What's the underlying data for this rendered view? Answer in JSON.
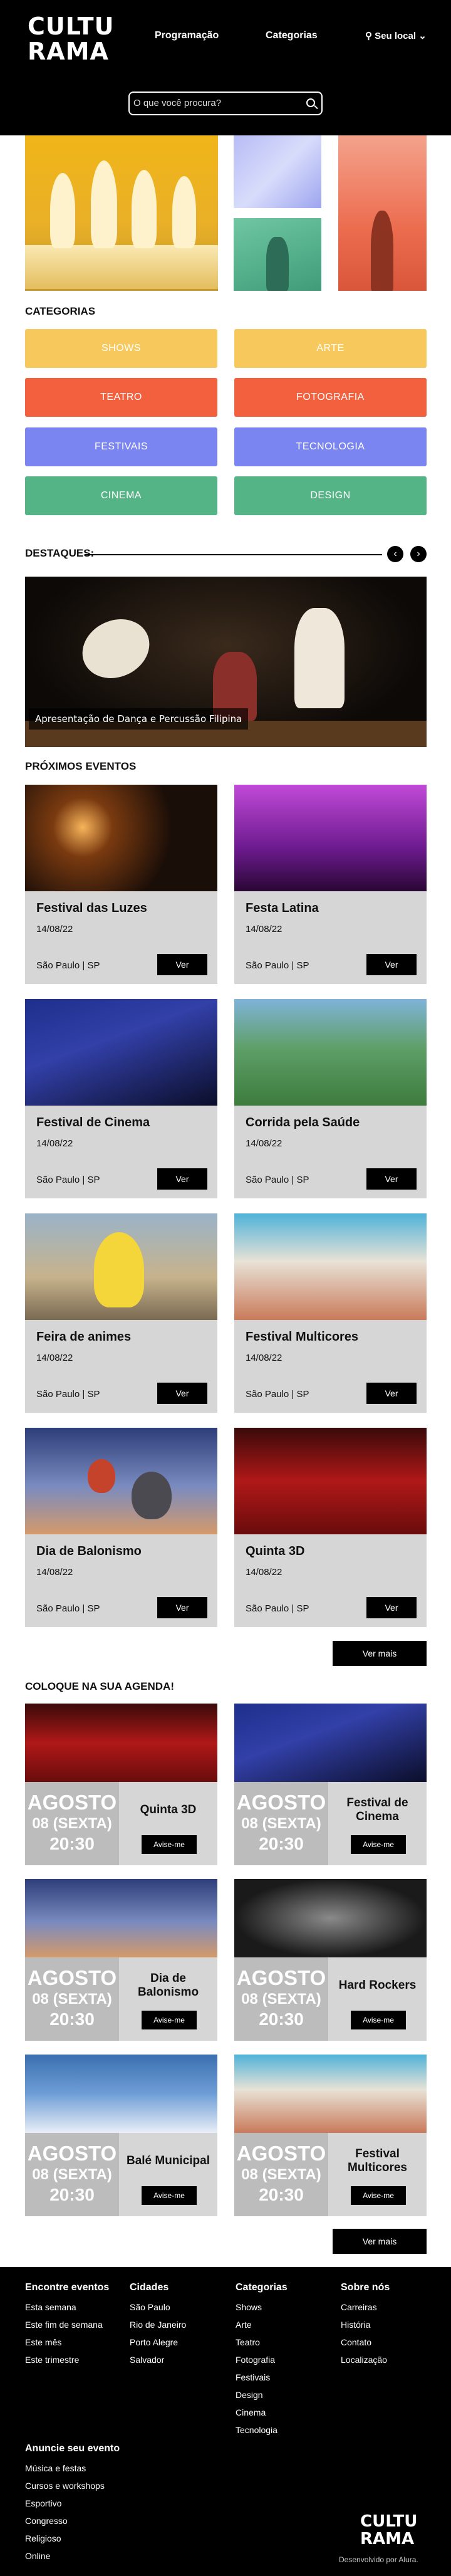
{
  "header": {
    "logo_line1": "CULTU",
    "logo_line2": "RAMA",
    "nav": [
      "Programação",
      "Categorias"
    ],
    "location": "Seu local",
    "search_placeholder": "O que você procura?"
  },
  "categories": {
    "title": "CATEGORIAS",
    "items": [
      {
        "label": "SHOWS",
        "color": "#f7c95c"
      },
      {
        "label": "ARTE",
        "color": "#f7c95c"
      },
      {
        "label": "TEATRO",
        "color": "#f2603e"
      },
      {
        "label": "FOTOGRAFIA",
        "color": "#f2603e"
      },
      {
        "label": "FESTIVAIS",
        "color": "#7b85f2"
      },
      {
        "label": "TECNOLOGIA",
        "color": "#7b85f2"
      },
      {
        "label": "CINEMA",
        "color": "#55b485"
      },
      {
        "label": "DESIGN",
        "color": "#55b485"
      }
    ]
  },
  "highlights": {
    "title": "DESTAQUES:",
    "caption": "Apresentação de Dança e Percussão Filipina",
    "prev": "‹",
    "next": "›"
  },
  "events": {
    "title": "PRÓXIMOS EVENTOS",
    "view_label": "Ver",
    "more_label": "Ver mais",
    "items": [
      {
        "title": "Festival das Luzes",
        "date": "14/08/22",
        "location": "São Paulo | SP"
      },
      {
        "title": "Festa Latina",
        "date": "14/08/22",
        "location": "São Paulo | SP"
      },
      {
        "title": "Festival de Cinema",
        "date": "14/08/22",
        "location": "São Paulo | SP"
      },
      {
        "title": "Corrida pela Saúde",
        "date": "14/08/22",
        "location": "São Paulo | SP"
      },
      {
        "title": "Feira de animes",
        "date": "14/08/22",
        "location": "São Paulo | SP"
      },
      {
        "title": "Festival Multicores",
        "date": "14/08/22",
        "location": "São Paulo | SP"
      },
      {
        "title": "Dia de Balonismo",
        "date": "14/08/22",
        "location": "São Paulo | SP"
      },
      {
        "title": "Quinta 3D",
        "date": "14/08/22",
        "location": "São Paulo | SP"
      }
    ]
  },
  "agenda": {
    "title": "COLOQUE NA SUA AGENDA!",
    "notify_label": "Avise-me",
    "more_label": "Ver mais",
    "items": [
      {
        "month": "AGOSTO",
        "day": "08 (SEXTA)",
        "time": "20:30",
        "name": "Quinta 3D"
      },
      {
        "month": "AGOSTO",
        "day": "08 (SEXTA)",
        "time": "20:30",
        "name": "Festival de Cinema"
      },
      {
        "month": "AGOSTO",
        "day": "08 (SEXTA)",
        "time": "20:30",
        "name": "Dia de Balonismo"
      },
      {
        "month": "AGOSTO",
        "day": "08 (SEXTA)",
        "time": "20:30",
        "name": "Hard Rockers"
      },
      {
        "month": "AGOSTO",
        "day": "08 (SEXTA)",
        "time": "20:30",
        "name": "Balé Municipal"
      },
      {
        "month": "AGOSTO",
        "day": "08 (SEXTA)",
        "time": "20:30",
        "name": "Festival Multicores"
      }
    ]
  },
  "footer": {
    "columns": [
      {
        "title": "Encontre eventos",
        "links": [
          "Esta semana",
          "Este fim de semana",
          "Este mês",
          "Este trimestre"
        ]
      },
      {
        "title": "Cidades",
        "links": [
          "São Paulo",
          "Rio de Janeiro",
          "Porto Alegre",
          "Salvador"
        ]
      },
      {
        "title": "Categorias",
        "links": [
          "Shows",
          "Arte",
          "Teatro",
          "Fotografia",
          "Festivais",
          "Design",
          "Cinema",
          "Tecnologia"
        ]
      },
      {
        "title": "Sobre nós",
        "links": [
          "Carreiras",
          "História",
          "Contato",
          "Localização"
        ]
      },
      {
        "title": "Anuncie seu evento",
        "links": [
          "Música e festas",
          "Cursos e workshops",
          "Esportivo",
          "Congresso",
          "Religioso",
          "Online"
        ]
      }
    ],
    "logo_line1": "CULTU",
    "logo_line2": "RAMA",
    "credit": "Desenvolvido por Alura."
  }
}
